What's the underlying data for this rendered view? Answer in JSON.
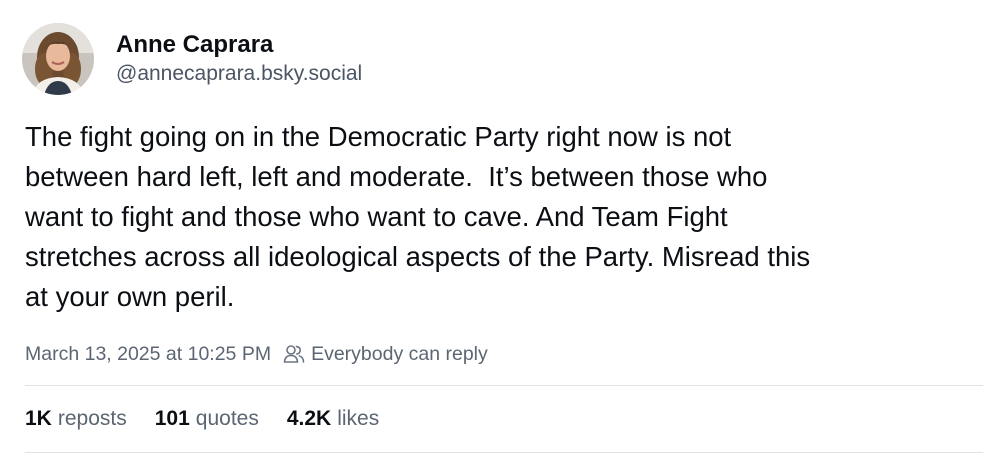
{
  "author": {
    "display_name": "Anne Caprara",
    "handle": "@annecaprara.bsky.social"
  },
  "post": {
    "text": "The fight going on in the Democratic Party right now is not\nbetween hard left, left and moderate.  It’s between those who\nwant to fight and those who want to cave. And Team Fight\nstretches across all ideological aspects of the Party. Misread this\nat your own peril.",
    "timestamp": "March 13, 2025 at 10:25 PM",
    "reply_setting": "Everybody can reply"
  },
  "stats": {
    "reposts": {
      "count": "1K",
      "label": "reposts"
    },
    "quotes": {
      "count": "101",
      "label": "quotes"
    },
    "likes": {
      "count": "4.2K",
      "label": "likes"
    }
  },
  "icons": {
    "avatar": "avatar-photo",
    "reply_setting_icon": "people-icon"
  },
  "colors": {
    "text_primary": "#0b0f14",
    "text_secondary": "#5b6672",
    "divider": "#dfe3e8"
  }
}
